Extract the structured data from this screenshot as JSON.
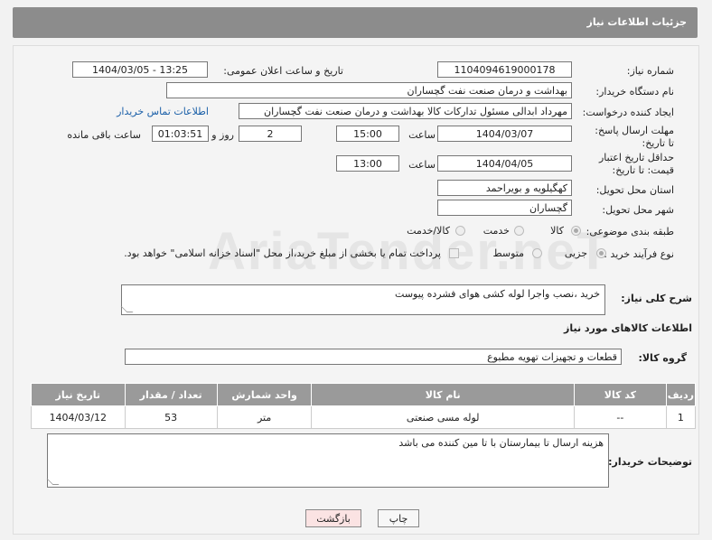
{
  "header": {
    "title": "جزئیات اطلاعات نیاز"
  },
  "form": {
    "need_number_label": "شماره نیاز:",
    "need_number": "1104094619000178",
    "announce_label": "تاریخ و ساعت اعلان عمومی:",
    "announce_value": "1404/03/05 - 13:25",
    "buyer_org_label": "نام دستگاه خریدار:",
    "buyer_org": "بهداشت و درمان صنعت نفت گچساران",
    "creator_label": "ایجاد کننده درخواست:",
    "creator": "مهرداد ابدالی مسئول تدارکات کالا  بهداشت و درمان صنعت نفت گچساران",
    "contact_link": "اطلاعات تماس خریدار",
    "deadline_label": "مهلت ارسال پاسخ: تا تاریخ:",
    "deadline_date": "1404/03/07",
    "time_label": "ساعت",
    "deadline_time": "15:00",
    "days_value": "2",
    "days_label": "روز و",
    "remaining_time": "01:03:51",
    "remaining_label": "ساعت باقی مانده",
    "validity_label": "حداقل تاریخ اعتبار قیمت: تا تاریخ:",
    "validity_date": "1404/04/05",
    "validity_time": "13:00",
    "province_label": "استان محل تحویل:",
    "province": "کهگیلویه و بویراحمد",
    "city_label": "شهر محل تحویل:",
    "city": "گچساران",
    "category_label": "طبقه بندی موضوعی:",
    "category_options": [
      "کالا",
      "خدمت",
      "کالا/خدمت"
    ],
    "process_label": "نوع فرآیند خرید :",
    "process_options": [
      "جزیی",
      "متوسط"
    ],
    "payment_note": "پرداخت تمام یا بخشی از مبلغ خرید،از محل \"اسناد خزانه اسلامی\" خواهد بود.",
    "desc_label": "شرح کلی نیاز:",
    "desc_value": "خرید ،نصب واجرا لوله کشی هوای فشرده پیوست"
  },
  "goods": {
    "section_title": "اطلاعات کالاهای مورد نیاز",
    "group_label": "گروه کالا:",
    "group_value": "قطعات و تجهیزات تهویه مطبوع",
    "columns": [
      "ردیف",
      "کد کالا",
      "نام کالا",
      "واحد شمارش",
      "تعداد / مقدار",
      "تاریخ نیاز"
    ],
    "rows": [
      [
        "1",
        "--",
        "لوله مسی صنعتی",
        "متر",
        "53",
        "1404/03/12"
      ]
    ]
  },
  "buyer_notes": {
    "label": "توضیحات خریدار:",
    "value": "هزینه ارسال تا بیمارستان با تا مین کننده می باشد"
  },
  "buttons": {
    "print": "چاپ",
    "back": "بازگشت"
  },
  "watermark": "AriaTender.neT"
}
